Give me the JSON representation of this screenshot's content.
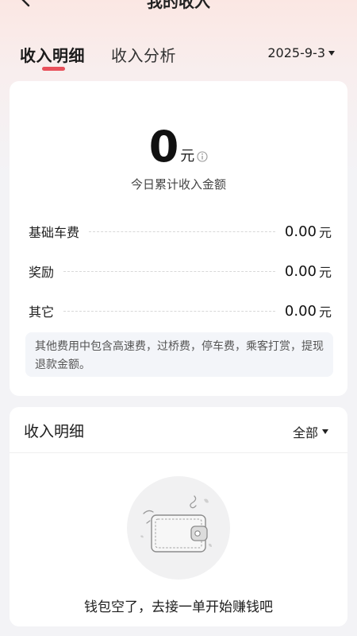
{
  "header": {
    "title": "我的收入",
    "back_icon": "chevron-left-icon"
  },
  "tabs": [
    {
      "label": "收入明细",
      "active": true
    },
    {
      "label": "收入分析",
      "active": false
    }
  ],
  "date_filter": {
    "value": "2025-9-3"
  },
  "summary": {
    "amount": "0",
    "unit": "元",
    "label": "今日累计收入金额",
    "items": [
      {
        "label": "基础车费",
        "value": "0.00",
        "unit": "元"
      },
      {
        "label": "奖励",
        "value": "0.00",
        "unit": "元"
      },
      {
        "label": "其它",
        "value": "0.00",
        "unit": "元"
      }
    ],
    "note": "其他费用中包含高速费，过桥费，停车费，乘客打赏，提现退款金额。"
  },
  "details": {
    "title": "收入明细",
    "filter": "全部",
    "empty_text": "钱包空了，去接一单开始赚钱吧"
  },
  "colors": {
    "accent": "#e8505b",
    "note_bg": "#f3f5f9",
    "page_bg": "#f3f3f6"
  }
}
